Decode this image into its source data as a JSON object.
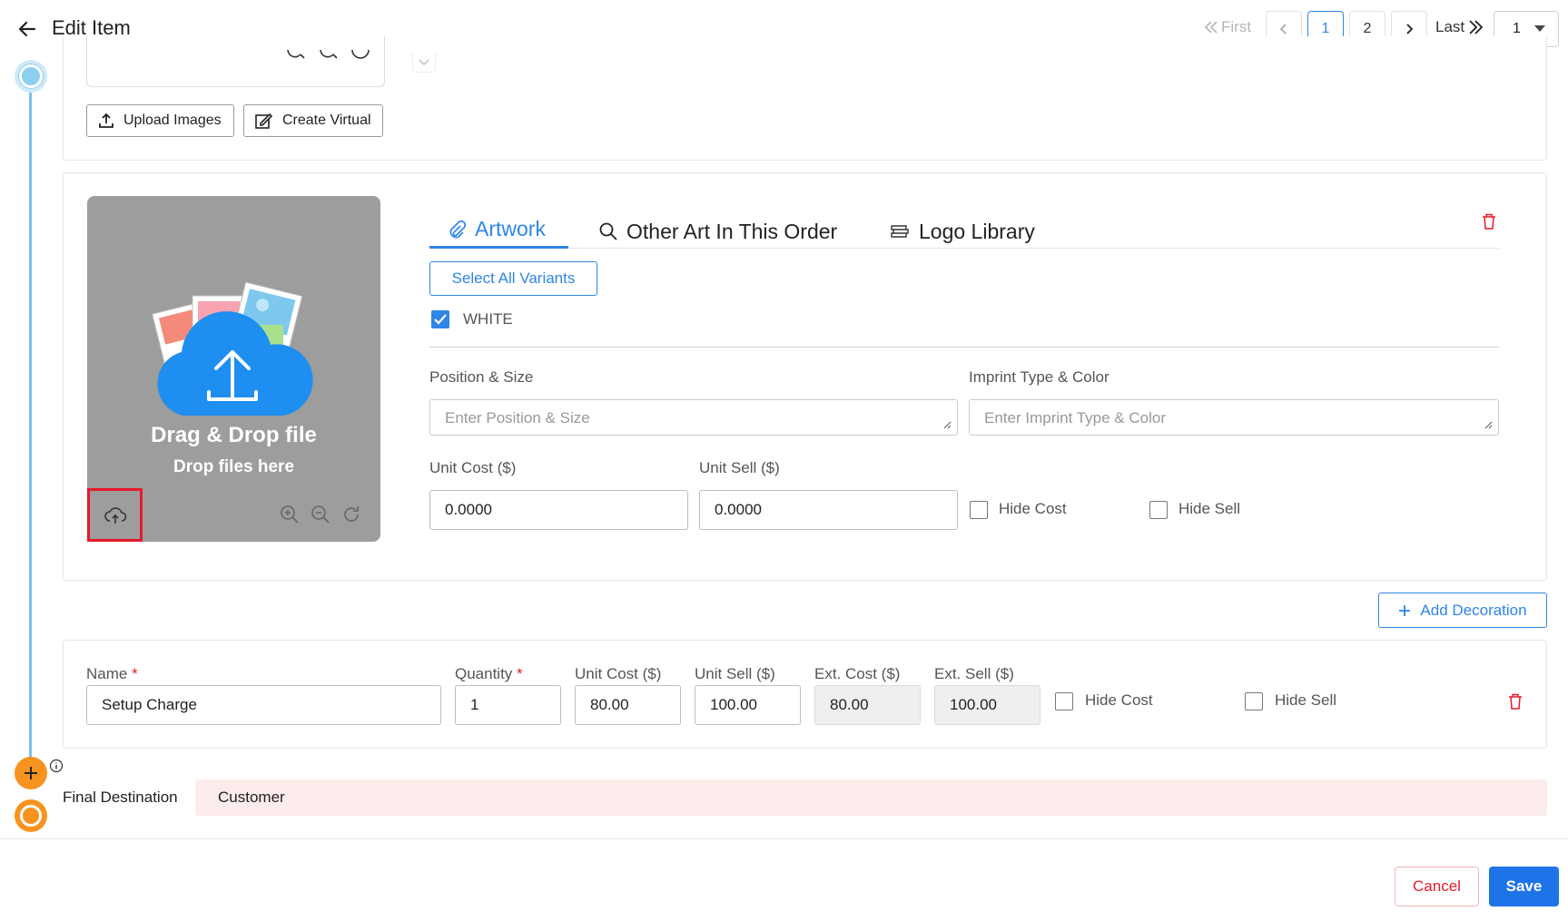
{
  "header": {
    "title": "Edit Item",
    "pager": {
      "first": "First",
      "last": "Last",
      "pages": [
        "1",
        "2"
      ],
      "current": "1",
      "select_value": "1"
    }
  },
  "images": {
    "upload_label": "Upload Images",
    "virtual_label": "Create Virtual"
  },
  "dropzone": {
    "title": "Drag & Drop file",
    "subtitle": "Drop files here"
  },
  "tabs": [
    {
      "label": "Artwork",
      "icon": "paperclip-icon",
      "active": true
    },
    {
      "label": "Other Art In This Order",
      "icon": "search-icon",
      "active": false
    },
    {
      "label": "Logo Library",
      "icon": "books-icon",
      "active": false
    }
  ],
  "artwork": {
    "select_all_label": "Select All Variants",
    "variant": {
      "label": "WHITE",
      "checked": true
    },
    "position_label": "Position & Size",
    "position_placeholder": "Enter Position & Size",
    "imprint_label": "Imprint Type & Color",
    "imprint_placeholder": "Enter Imprint Type & Color",
    "unit_cost_label": "Unit Cost ($)",
    "unit_cost_value": "0.0000",
    "unit_sell_label": "Unit Sell ($)",
    "unit_sell_value": "0.0000",
    "hide_cost_label": "Hide Cost",
    "hide_sell_label": "Hide Sell"
  },
  "add_decoration_label": "Add Decoration",
  "charge": {
    "name_label": "Name",
    "name_value": "Setup Charge",
    "qty_label": "Quantity",
    "qty_value": "1",
    "unit_cost_label": "Unit Cost ($)",
    "unit_cost_value": "80.00",
    "unit_sell_label": "Unit Sell ($)",
    "unit_sell_value": "100.00",
    "ext_cost_label": "Ext. Cost ($)",
    "ext_cost_value": "80.00",
    "ext_sell_label": "Ext. Sell ($)",
    "ext_sell_value": "100.00",
    "hide_cost_label": "Hide Cost",
    "hide_sell_label": "Hide Sell",
    "required_mark": "*"
  },
  "final_destination": {
    "label": "Final Destination",
    "value": "Customer"
  },
  "footer": {
    "cancel_label": "Cancel",
    "save_label": "Save"
  },
  "colors": {
    "accent": "#2f86e6",
    "danger": "#e6192a",
    "timeline": "#79c2ec",
    "orange": "#f7931e",
    "dropzone": "#9d9d9d"
  }
}
